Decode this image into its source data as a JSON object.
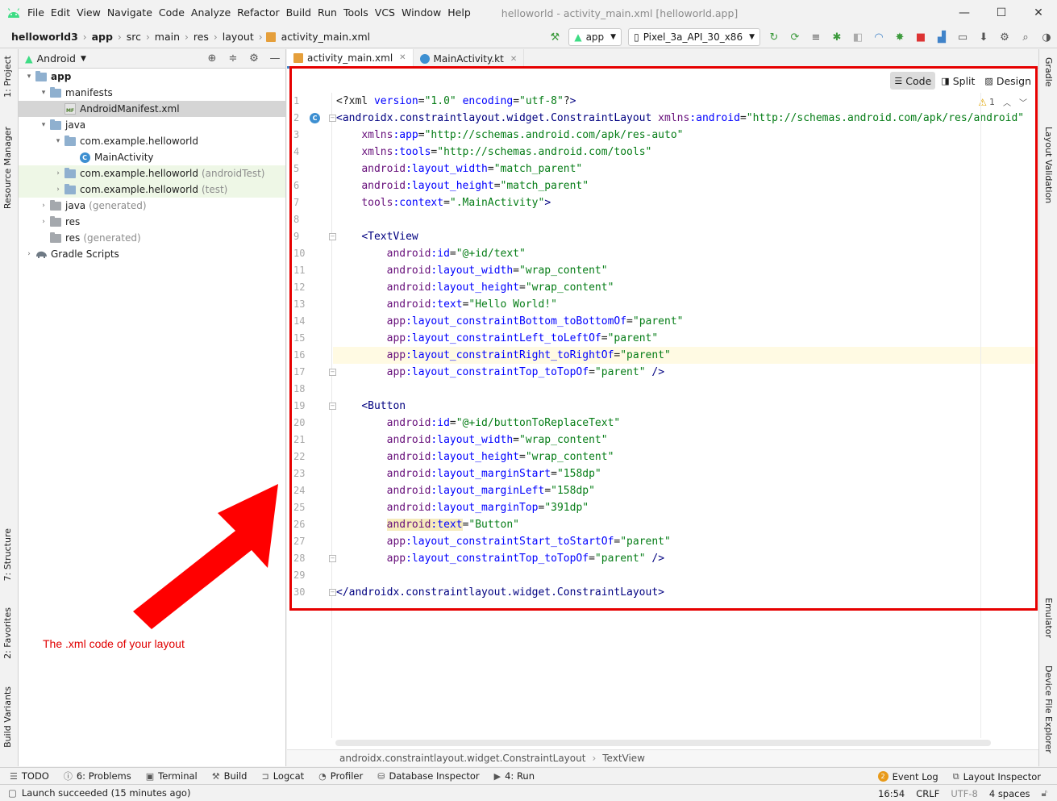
{
  "window": {
    "title": "helloworld - activity_main.xml [helloworld.app]",
    "controls": [
      "—",
      "☐",
      "✕"
    ]
  },
  "menu": [
    "File",
    "Edit",
    "View",
    "Navigate",
    "Code",
    "Analyze",
    "Refactor",
    "Build",
    "Run",
    "Tools",
    "VCS",
    "Window",
    "Help"
  ],
  "breadcrumb": [
    "helloworld3",
    "app",
    "src",
    "main",
    "res",
    "layout",
    "activity_main.xml"
  ],
  "toolbar": {
    "run_config": "app",
    "device": "Pixel_3a_API_30_x86"
  },
  "left_tabs": {
    "project": "1: Project",
    "resource_manager": "Resource Manager",
    "structure": "7: Structure",
    "favorites": "2: Favorites",
    "build_variants": "Build Variants"
  },
  "right_tabs": {
    "gradle": "Gradle",
    "layout_validation": "Layout Validation",
    "emulator": "Emulator",
    "device_file_explorer": "Device File Explorer"
  },
  "project": {
    "view": "Android",
    "tree": [
      {
        "label": "app",
        "suffix": "",
        "indent": 0,
        "chev": "▾",
        "icon": "folder",
        "bold": true
      },
      {
        "label": "manifests",
        "suffix": "",
        "indent": 1,
        "chev": "▾",
        "icon": "folder"
      },
      {
        "label": "AndroidManifest.xml",
        "suffix": "",
        "indent": 2,
        "chev": "",
        "icon": "manifest",
        "selected": true
      },
      {
        "label": "java",
        "suffix": "",
        "indent": 1,
        "chev": "▾",
        "icon": "folder"
      },
      {
        "label": "com.example.helloworld",
        "suffix": "",
        "indent": 2,
        "chev": "▾",
        "icon": "folder"
      },
      {
        "label": "MainActivity",
        "suffix": "",
        "indent": 3,
        "chev": "",
        "icon": "kotlin"
      },
      {
        "label": "com.example.helloworld",
        "suffix": "(androidTest)",
        "indent": 2,
        "chev": "›",
        "icon": "folder",
        "test": true
      },
      {
        "label": "com.example.helloworld",
        "suffix": "(test)",
        "indent": 2,
        "chev": "›",
        "icon": "folder",
        "test": true
      },
      {
        "label": "java",
        "suffix": "(generated)",
        "indent": 1,
        "chev": "›",
        "icon": "folder-gray"
      },
      {
        "label": "res",
        "suffix": "",
        "indent": 1,
        "chev": "›",
        "icon": "folder-gray"
      },
      {
        "label": "res",
        "suffix": "(generated)",
        "indent": 1,
        "chev": "",
        "icon": "folder-gray"
      },
      {
        "label": "Gradle Scripts",
        "suffix": "",
        "indent": 0,
        "chev": "›",
        "icon": "gradle"
      }
    ]
  },
  "editor": {
    "tabs": [
      {
        "label": "activity_main.xml",
        "active": true
      },
      {
        "label": "MainActivity.kt",
        "active": false
      }
    ],
    "view_modes": [
      "Code",
      "Split",
      "Design"
    ],
    "warning_count": "1",
    "caret_line": 16,
    "lines": [
      "<?xml version=\"1.0\" encoding=\"utf-8\"?>",
      "<androidx.constraintlayout.widget.ConstraintLayout xmlns:android=\"http://schemas.android.com/apk/res/android\"",
      "    xmlns:app=\"http://schemas.android.com/apk/res-auto\"",
      "    xmlns:tools=\"http://schemas.android.com/tools\"",
      "    android:layout_width=\"match_parent\"",
      "    android:layout_height=\"match_parent\"",
      "    tools:context=\".MainActivity\">",
      "",
      "    <TextView",
      "        android:id=\"@+id/text\"",
      "        android:layout_width=\"wrap_content\"",
      "        android:layout_height=\"wrap_content\"",
      "        android:text=\"Hello World!\"",
      "        app:layout_constraintBottom_toBottomOf=\"parent\"",
      "        app:layout_constraintLeft_toLeftOf=\"parent\"",
      "        app:layout_constraintRight_toRightOf=\"parent\"",
      "        app:layout_constraintTop_toTopOf=\"parent\" />",
      "",
      "    <Button",
      "        android:id=\"@+id/buttonToReplaceText\"",
      "        android:layout_width=\"wrap_content\"",
      "        android:layout_height=\"wrap_content\"",
      "        android:layout_marginStart=\"158dp\"",
      "        android:layout_marginLeft=\"158dp\"",
      "        android:layout_marginTop=\"391dp\"",
      "        android:text=\"Button\"",
      "        app:layout_constraintStart_toStartOf=\"parent\"",
      "        app:layout_constraintTop_toTopOf=\"parent\" />",
      "",
      "</androidx.constraintlayout.widget.ConstraintLayout>"
    ],
    "breadcrumb": [
      "androidx.constraintlayout.widget.ConstraintLayout",
      "TextView"
    ]
  },
  "annotation": "The .xml code of your layout",
  "tool_windows": {
    "left": [
      {
        "label": "TODO",
        "glyph": "☰"
      },
      {
        "label": "6: Problems",
        "glyph": "ⓘ"
      },
      {
        "label": "Terminal",
        "glyph": "▣"
      },
      {
        "label": "Build",
        "glyph": "⚒"
      },
      {
        "label": "Logcat",
        "glyph": "⊐"
      },
      {
        "label": "Profiler",
        "glyph": "◔"
      },
      {
        "label": "Database Inspector",
        "glyph": "⛁"
      },
      {
        "label": "4: Run",
        "glyph": "▶"
      }
    ],
    "event_log": "Event Log",
    "event_count": "2",
    "layout_inspector": "Layout Inspector"
  },
  "status": {
    "message": "Launch succeeded (15 minutes ago)",
    "position": "16:54",
    "line_sep": "CRLF",
    "encoding": "UTF-8",
    "indent": "4 spaces"
  },
  "colors": {
    "accent": "#4083c9",
    "annotation_red": "#e60000",
    "tag": "#000080",
    "namespace": "#660e7a",
    "attr": "#0000ff",
    "value": "#067d17"
  }
}
